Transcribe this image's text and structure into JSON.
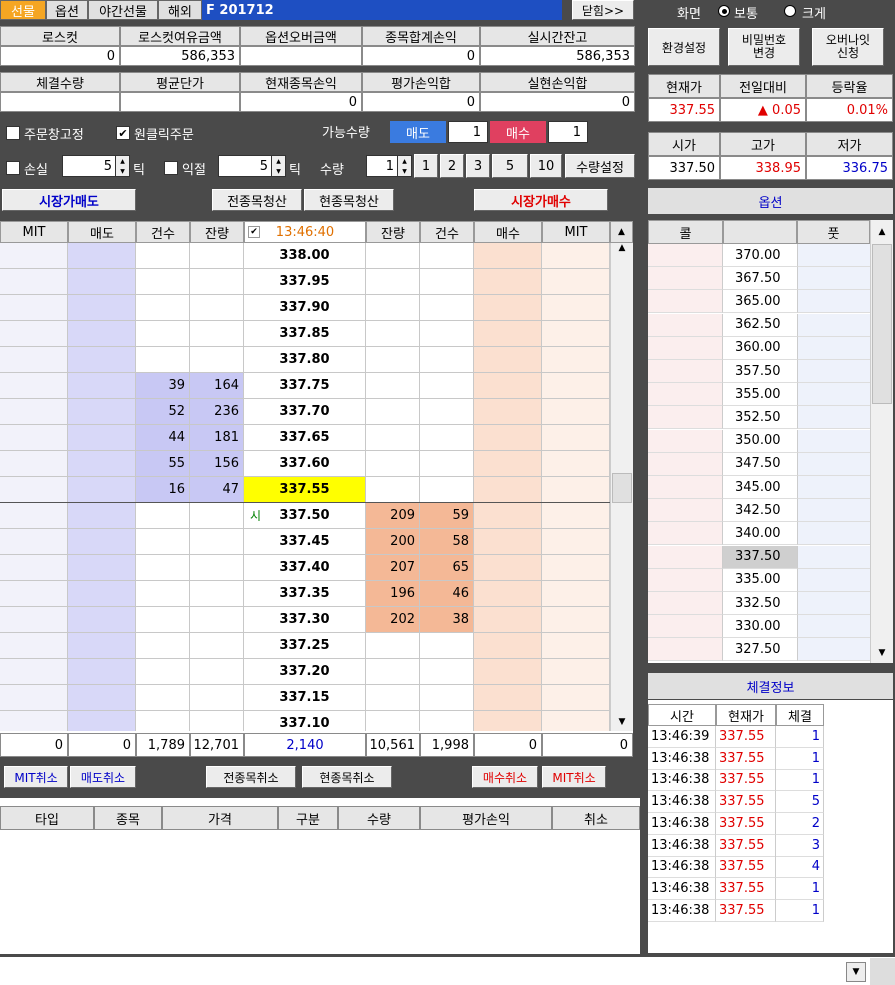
{
  "tabs": [
    "선물",
    "옵션",
    "야간선물",
    "해외"
  ],
  "product_code": "F 201712",
  "close_btn": "닫힘>>",
  "summary1": {
    "headers": [
      "로스컷",
      "로스컷여유금액",
      "옵션오버금액",
      "종목합계손익",
      "실시간잔고"
    ],
    "values": [
      "0",
      "586,353",
      "",
      "0",
      "586,353"
    ]
  },
  "summary2": {
    "headers": [
      "체결수량",
      "평균단가",
      "현재종목손익",
      "평가손익합",
      "실현손익합"
    ],
    "values": [
      "",
      "",
      "0",
      "0",
      "0"
    ]
  },
  "options": {
    "fix_order": "주문창고정",
    "one_click": "원클릭주문",
    "available_qty": "가능수량",
    "sell_label": "매도",
    "sell_qty": "1",
    "buy_label": "매수",
    "buy_qty": "1"
  },
  "stops": {
    "loss": "손실",
    "loss_val": "5",
    "loss_unit": "틱",
    "profit": "익절",
    "profit_val": "5",
    "profit_unit": "틱",
    "qty": "수량",
    "qty_val": "1",
    "presets": [
      "1",
      "2",
      "3",
      "5",
      "10"
    ],
    "qty_setting": "수량설정"
  },
  "actions": {
    "market_sell": "시장가매도",
    "liquidate_all": "전종목청산",
    "liquidate_current": "현종목청산",
    "market_buy": "시장가매수"
  },
  "orderbook": {
    "headers": [
      "MIT",
      "매도",
      "건수",
      "잔량",
      "13:46:40",
      "잔량",
      "건수",
      "매수",
      "MIT"
    ],
    "rows": [
      {
        "price": "338.00",
        "sc": "",
        "sq": "",
        "bq": "",
        "bc": ""
      },
      {
        "price": "337.95",
        "sc": "",
        "sq": "",
        "bq": "",
        "bc": ""
      },
      {
        "price": "337.90",
        "sc": "",
        "sq": "",
        "bq": "",
        "bc": ""
      },
      {
        "price": "337.85",
        "sc": "",
        "sq": "",
        "bq": "",
        "bc": ""
      },
      {
        "price": "337.80",
        "sc": "",
        "sq": "",
        "bq": "",
        "bc": ""
      },
      {
        "price": "337.75",
        "sc": "39",
        "sq": "164",
        "bq": "",
        "bc": ""
      },
      {
        "price": "337.70",
        "sc": "52",
        "sq": "236",
        "bq": "",
        "bc": ""
      },
      {
        "price": "337.65",
        "sc": "44",
        "sq": "181",
        "bq": "",
        "bc": ""
      },
      {
        "price": "337.60",
        "sc": "55",
        "sq": "156",
        "bq": "",
        "bc": ""
      },
      {
        "price": "337.55",
        "sc": "16",
        "sq": "47",
        "bq": "",
        "bc": ""
      },
      {
        "price": "337.50",
        "sc": "",
        "sq": "",
        "bq": "209",
        "bc": "59",
        "mark": "시"
      },
      {
        "price": "337.45",
        "sc": "",
        "sq": "",
        "bq": "200",
        "bc": "58"
      },
      {
        "price": "337.40",
        "sc": "",
        "sq": "",
        "bq": "207",
        "bc": "65"
      },
      {
        "price": "337.35",
        "sc": "",
        "sq": "",
        "bq": "196",
        "bc": "46"
      },
      {
        "price": "337.30",
        "sc": "",
        "sq": "",
        "bq": "202",
        "bc": "38"
      },
      {
        "price": "337.25",
        "sc": "",
        "sq": "",
        "bq": "",
        "bc": ""
      },
      {
        "price": "337.20",
        "sc": "",
        "sq": "",
        "bq": "",
        "bc": ""
      },
      {
        "price": "337.15",
        "sc": "",
        "sq": "",
        "bq": "",
        "bc": ""
      },
      {
        "price": "337.10",
        "sc": "",
        "sq": "",
        "bq": "",
        "bc": ""
      }
    ],
    "totals": [
      "0",
      "0",
      "1,789",
      "12,701",
      "2,140",
      "10,561",
      "1,998",
      "0",
      "0"
    ]
  },
  "cancel": {
    "mit_cancel": "MIT취소",
    "sell_cancel": "매도취소",
    "all_cancel": "전종목취소",
    "cur_cancel": "현종목취소",
    "buy_cancel": "매수취소",
    "mit_cancel2": "MIT취소"
  },
  "positions": {
    "headers": [
      "타입",
      "종목",
      "가격",
      "구분",
      "수량",
      "평가손익",
      "취소"
    ]
  },
  "right": {
    "screen": "화면",
    "normal": "보통",
    "large": "크게",
    "env": "환경설정",
    "pw": "비밀번호\n변경",
    "ovn": "오버나잇\n신청",
    "q_headers": [
      "현재가",
      "전일대비",
      "등락율"
    ],
    "q_values": [
      "337.55",
      "▲ 0.05",
      "0.01%"
    ],
    "o_headers": [
      "시가",
      "고가",
      "저가"
    ],
    "o_values": [
      "337.50",
      "338.95",
      "336.75"
    ],
    "option_title": "옵션",
    "call": "콜",
    "put": "풋",
    "strikes": [
      "370.00",
      "367.50",
      "365.00",
      "362.50",
      "360.00",
      "357.50",
      "355.00",
      "352.50",
      "350.00",
      "347.50",
      "345.00",
      "342.50",
      "340.00",
      "337.50",
      "335.00",
      "332.50",
      "330.00",
      "327.50"
    ],
    "trades_title": "체결정보",
    "t_headers": [
      "시간",
      "현재가",
      "체결"
    ],
    "trades": [
      [
        "13:46:39",
        "337.55",
        "1"
      ],
      [
        "13:46:38",
        "337.55",
        "1"
      ],
      [
        "13:46:38",
        "337.55",
        "1"
      ],
      [
        "13:46:38",
        "337.55",
        "5"
      ],
      [
        "13:46:38",
        "337.55",
        "2"
      ],
      [
        "13:46:38",
        "337.55",
        "3"
      ],
      [
        "13:46:38",
        "337.55",
        "4"
      ],
      [
        "13:46:38",
        "337.55",
        "1"
      ],
      [
        "13:46:38",
        "337.55",
        "1"
      ]
    ]
  }
}
